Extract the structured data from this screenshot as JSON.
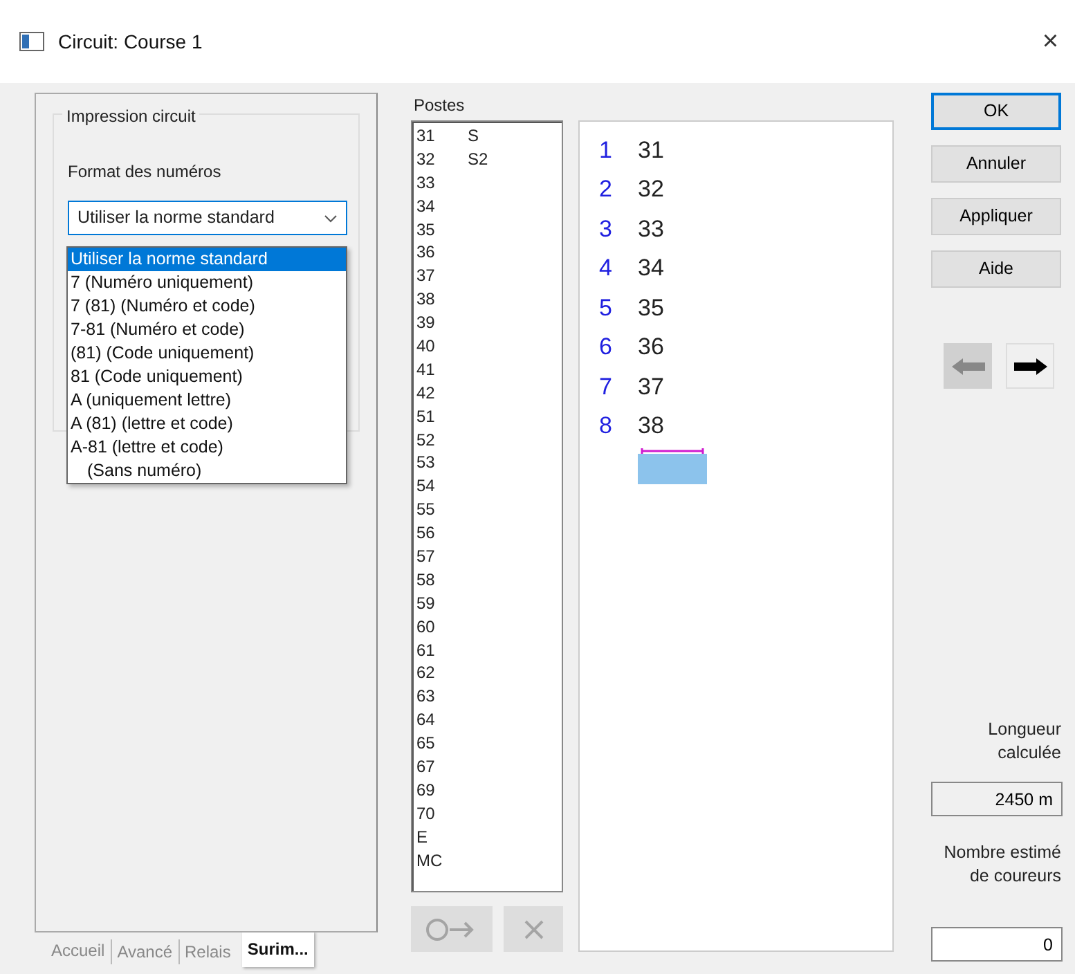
{
  "window": {
    "title": "Circuit: Course 1",
    "close": "×"
  },
  "left_panel": {
    "group_title": "Impression circuit",
    "format_label": "Format des numéros",
    "dropdown": {
      "value": "Utiliser la norme standard",
      "expanded": true,
      "options": [
        {
          "label": "Utiliser la norme standard",
          "selected": true
        },
        {
          "label": "7 (Numéro uniquement)",
          "selected": false
        },
        {
          "label": "7 (81) (Numéro et code)",
          "selected": false
        },
        {
          "label": "7-81 (Numéro et code)",
          "selected": false
        },
        {
          "label": "(81) (Code uniquement)",
          "selected": false
        },
        {
          "label": "81 (Code uniquement)",
          "selected": false
        },
        {
          "label": "A (uniquement lettre)",
          "selected": false
        },
        {
          "label": "A (81) (lettre et code)",
          "selected": false
        },
        {
          "label": "A-81 (lettre et code)",
          "selected": false
        },
        {
          "label": "(Sans numéro)",
          "selected": false
        }
      ]
    }
  },
  "tabs": [
    {
      "label": "Accueil",
      "selected": false
    },
    {
      "label": "Avancé",
      "selected": false
    },
    {
      "label": "Relais",
      "selected": false
    },
    {
      "label": "Surim...",
      "selected": true
    }
  ],
  "postes": {
    "title": "Postes",
    "items": [
      {
        "code": "31",
        "note": "S"
      },
      {
        "code": "32",
        "note": "S2"
      },
      {
        "code": "33"
      },
      {
        "code": "34"
      },
      {
        "code": "35"
      },
      {
        "code": "36"
      },
      {
        "code": "37"
      },
      {
        "code": "38"
      },
      {
        "code": "39"
      },
      {
        "code": "40"
      },
      {
        "code": "41"
      },
      {
        "code": "42"
      },
      {
        "code": "51"
      },
      {
        "code": "52"
      },
      {
        "code": "53"
      },
      {
        "code": "54"
      },
      {
        "code": "55"
      },
      {
        "code": "56"
      },
      {
        "code": "57"
      },
      {
        "code": "58"
      },
      {
        "code": "59"
      },
      {
        "code": "60"
      },
      {
        "code": "61"
      },
      {
        "code": "62"
      },
      {
        "code": "63"
      },
      {
        "code": "64"
      },
      {
        "code": "65"
      },
      {
        "code": "67"
      },
      {
        "code": "69"
      },
      {
        "code": "70"
      },
      {
        "code": "E"
      },
      {
        "code": "MC"
      }
    ],
    "add_button": {
      "disabled": true
    },
    "remove_button": {
      "disabled": true
    }
  },
  "course": {
    "legs": [
      {
        "number": "1",
        "control": "31"
      },
      {
        "number": "2",
        "control": "32"
      },
      {
        "number": "3",
        "control": "33"
      },
      {
        "number": "4",
        "control": "34"
      },
      {
        "number": "5",
        "control": "35"
      },
      {
        "number": "6",
        "control": "36"
      },
      {
        "number": "7",
        "control": "37"
      },
      {
        "number": "8",
        "control": "38"
      }
    ]
  },
  "buttons": [
    {
      "label": "OK",
      "default": true
    },
    {
      "label": "Annuler",
      "default": false
    },
    {
      "label": "Appliquer",
      "default": false
    },
    {
      "label": "Aide",
      "default": false
    }
  ],
  "nav": {
    "previous_disabled": true,
    "next_disabled": false
  },
  "length": {
    "label": "Longueur calculée",
    "value": "2450 m"
  },
  "runners": {
    "label": "Nombre estimé de coureurs",
    "value": "0"
  }
}
